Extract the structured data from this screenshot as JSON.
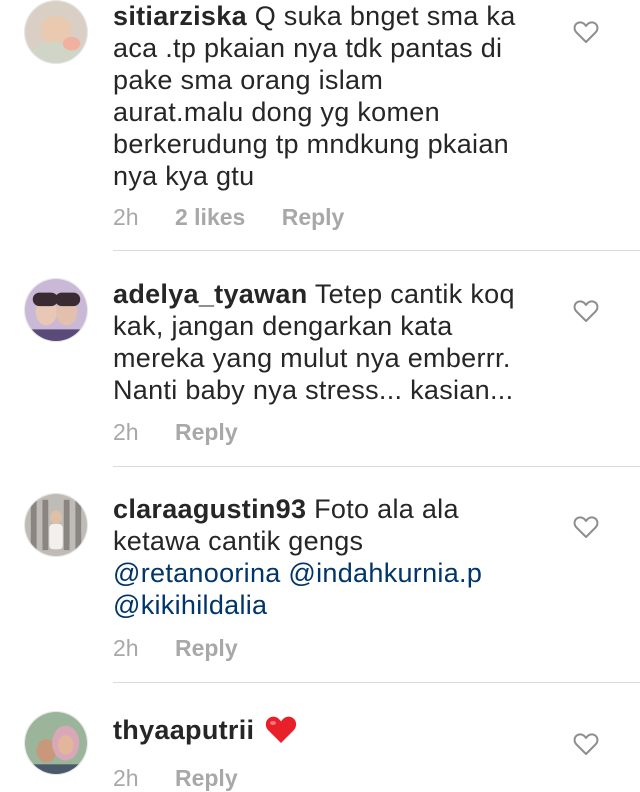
{
  "comments": [
    {
      "username": "sitiarziska",
      "text": "Q suka bnget sma ka aca .tp pkaian nya tdk pantas di pake sma orang islam aurat.malu dong yg komen berkerudung tp mndkung pkaian nya kya gtu",
      "lines": [
        "Q suka bnget sma ka",
        "aca .tp pkaian nya tdk pantas di",
        "pake sma orang islam",
        "aurat.malu dong yg komen",
        "berkerudung tp mndkung pkaian",
        "nya kya gtu"
      ],
      "time": "2h",
      "likes": "2 likes",
      "reply": "Reply"
    },
    {
      "username": "adelya_tyawan",
      "lines": [
        "Tetep cantik koq",
        "kak, jangan dengarkan kata",
        "mereka yang mulut nya emberrr.",
        "Nanti baby nya stress... kasian..."
      ],
      "time": "2h",
      "reply": "Reply"
    },
    {
      "username": "claraagustin93",
      "lines": [
        "Foto ala ala",
        "ketawa cantik gengs"
      ],
      "mentions": [
        "@retanoorina",
        "@indahkurnia.p",
        "@kikihildalia"
      ],
      "time": "2h",
      "reply": "Reply"
    },
    {
      "username": "thyaaputrii",
      "emoji": "red-heart",
      "time": "2h",
      "reply": "Reply"
    }
  ],
  "colors": {
    "text": "#262626",
    "meta": "#a8a8a8",
    "mention": "#003569",
    "heart_emoji": "#e8202a",
    "separator": "#dbdbdb"
  },
  "icons": [
    "heart-outline-icon",
    "red-heart-emoji"
  ]
}
